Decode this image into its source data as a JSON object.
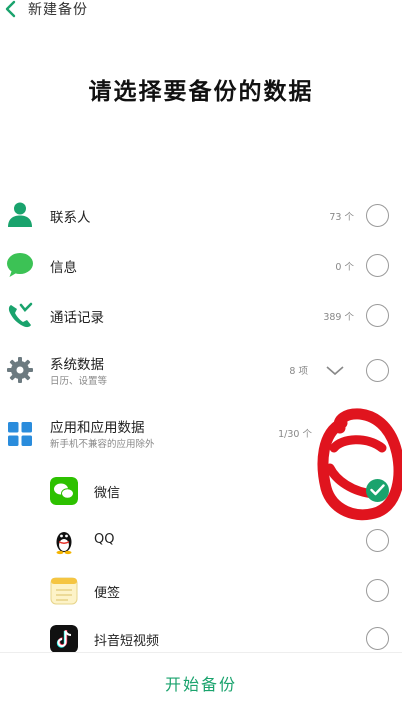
{
  "header": {
    "title": "新建备份",
    "icon": "back-arrow-icon"
  },
  "heading": "请选择要备份的数据",
  "items": [
    {
      "label": "联系人",
      "count": "73 个",
      "icon": "contact-person-icon"
    },
    {
      "label": "信息",
      "count": "0 个",
      "icon": "message-bubble-icon"
    },
    {
      "label": "通话记录",
      "count": "389 个",
      "icon": "phone-icon"
    },
    {
      "label": "系统数据",
      "sublabel": "日历、设置等",
      "count": "8 项",
      "icon": "gear-icon"
    },
    {
      "label": "应用和应用数据",
      "sublabel": "新手机不兼容的应用除外",
      "count": "1/30 个",
      "icon": "apps-grid-icon"
    }
  ],
  "apps": [
    {
      "label": "微信",
      "checked": true,
      "icon": "wechat-icon"
    },
    {
      "label": "QQ",
      "checked": false,
      "icon": "qq-penguin-icon"
    },
    {
      "label": "便签",
      "checked": false,
      "icon": "notes-icon"
    },
    {
      "label": "抖音短视频",
      "checked": false,
      "icon": "douyin-icon"
    }
  ],
  "footer": {
    "button_label": "开始备份"
  },
  "colors": {
    "accent": "#1aa36d",
    "annotation": "#e0141e"
  }
}
